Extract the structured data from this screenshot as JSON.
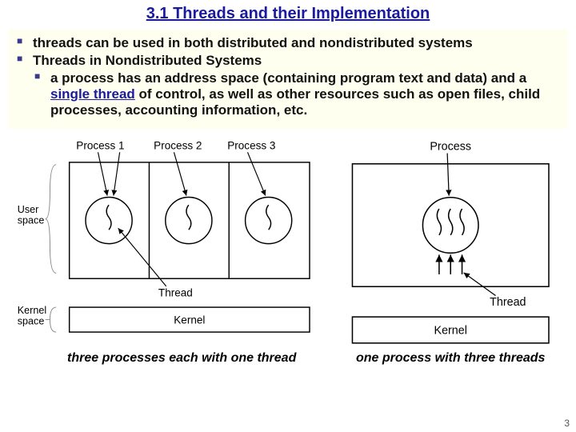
{
  "title": "3.1 Threads and their Implementation",
  "bullets": {
    "b1": "threads can be used in both distributed and nondistributed systems",
    "b2": "Threads in Nondistributed Systems",
    "b2a_pre": "a process has an address space (containing program text and data) and a ",
    "b2a_mid": "single thread",
    "b2a_post": " of control, as well as other resources such as open files, child processes, accounting information, etc."
  },
  "diag_left": {
    "proc1": "Process 1",
    "proc2": "Process 2",
    "proc3": "Process 3",
    "user_space": "User\nspace",
    "kernel_space": "Kernel\nspace",
    "thread": "Thread",
    "kernel": "Kernel"
  },
  "diag_right": {
    "process": "Process",
    "thread": "Thread",
    "kernel": "Kernel"
  },
  "captions": {
    "left": "three processes each with one thread",
    "right": "one process with three threads"
  },
  "pagenum": "3"
}
